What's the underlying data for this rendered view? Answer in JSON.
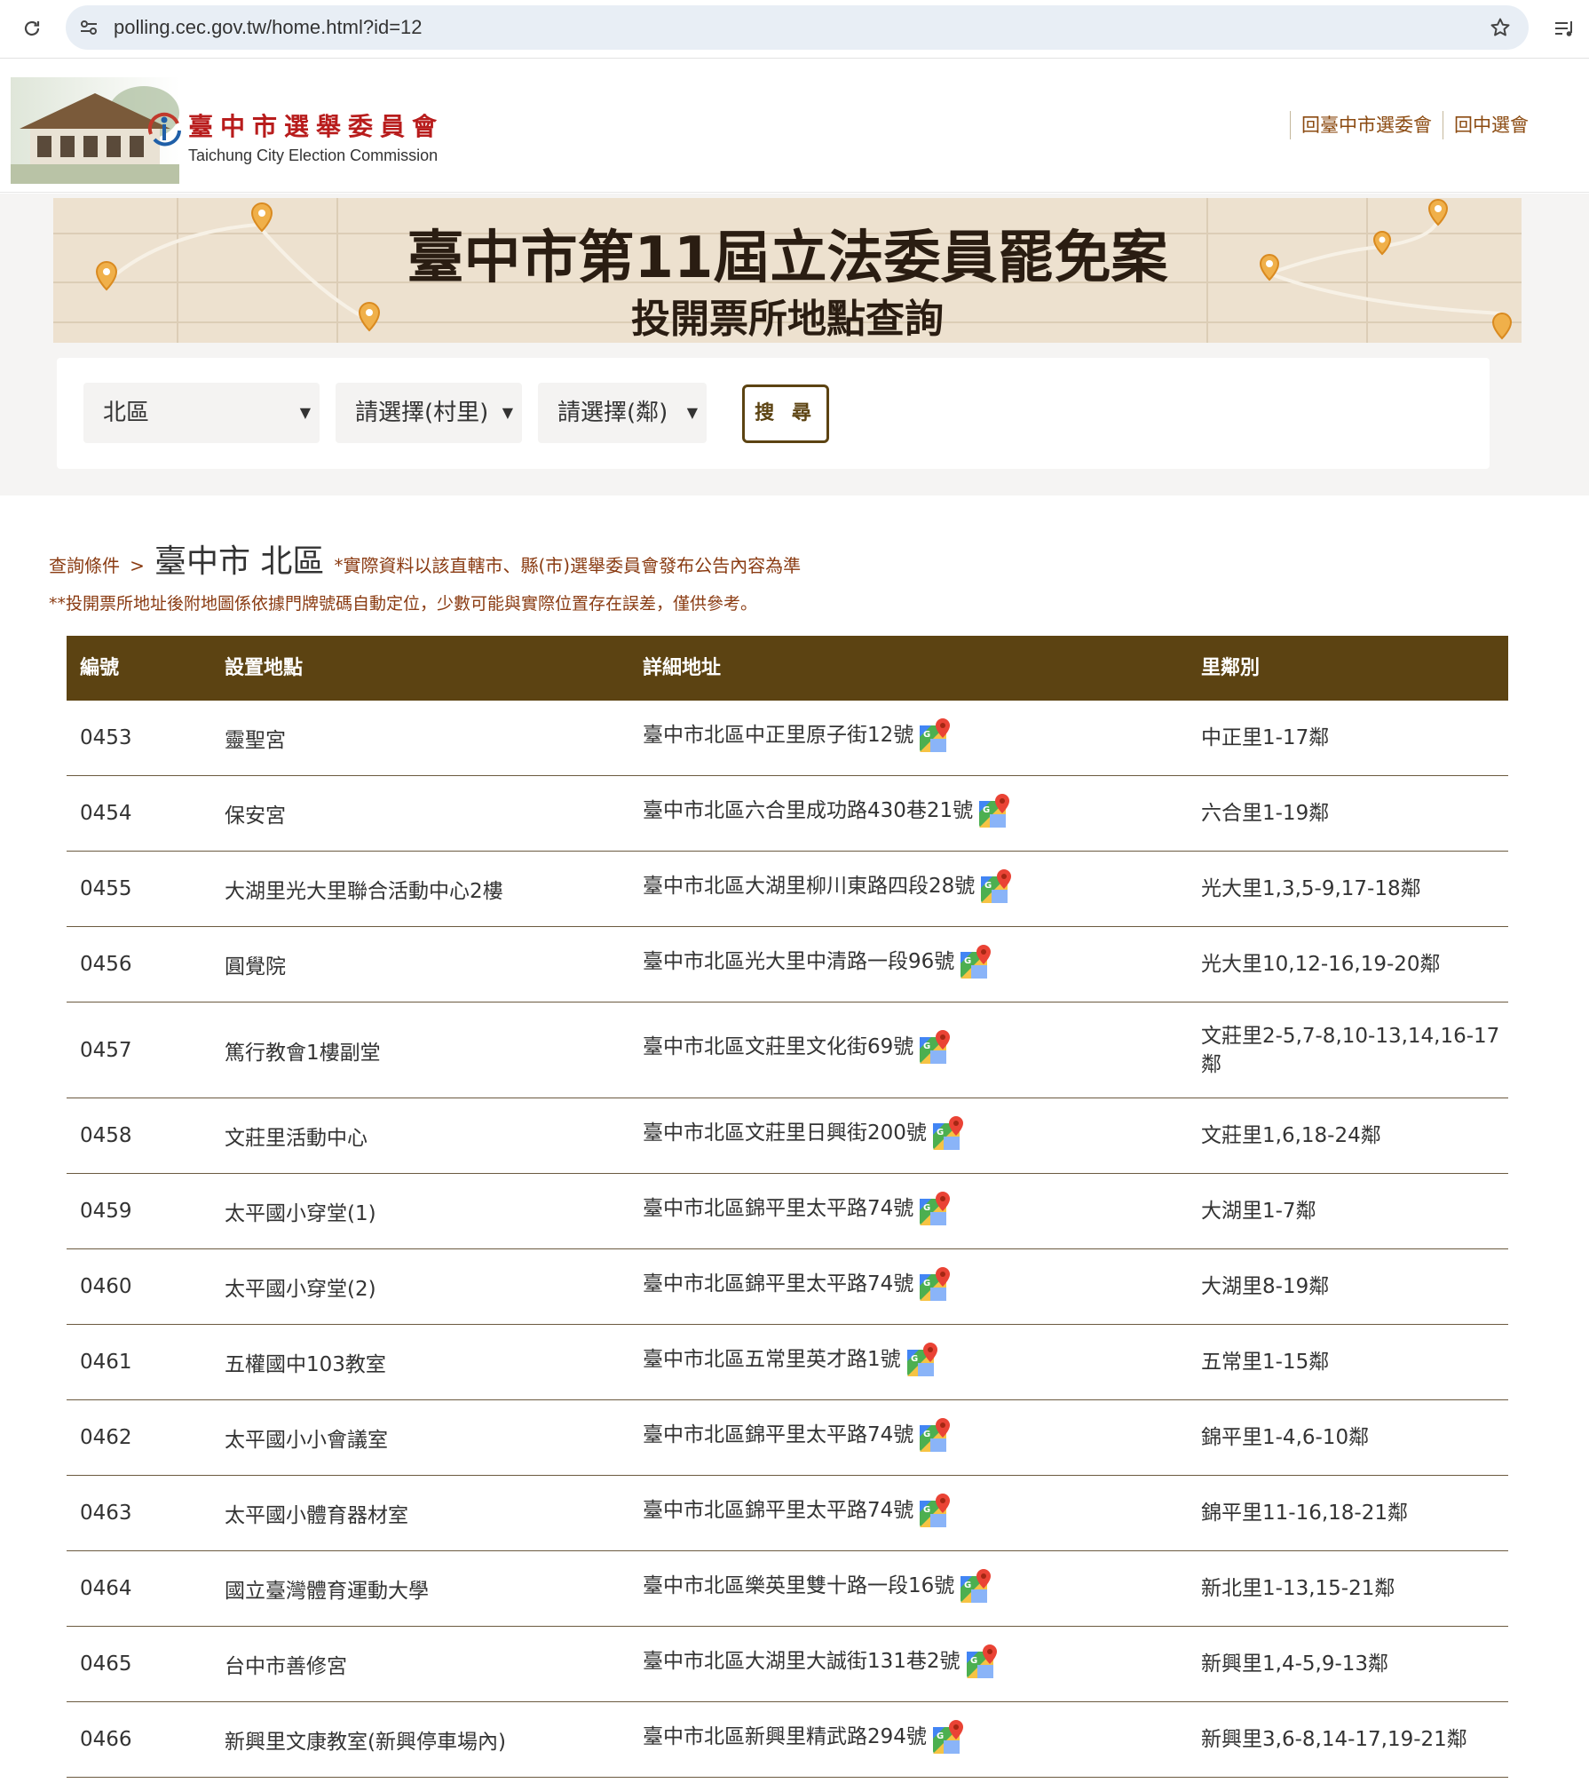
{
  "browser": {
    "url": "polling.cec.gov.tw/home.html?id=12"
  },
  "header": {
    "logo_title": "臺中市選舉委員會",
    "logo_subtitle": "Taichung City Election Commission",
    "links": [
      "回臺中市選委會",
      "回中選會"
    ]
  },
  "banner": {
    "title": "臺中市第11屆立法委員罷免案",
    "subtitle": "投開票所地點查詢"
  },
  "search": {
    "district": "北區",
    "village": "請選擇(村里)",
    "neighborhood": "請選擇(鄰)",
    "button": "搜 尋"
  },
  "result": {
    "condition_label": "查詢條件",
    "separator": ">",
    "place": "臺中市 北區",
    "note1": "*實際資料以該直轄市、縣(市)選舉委員會發布公告內容為準",
    "note2": "**投開票所地址後附地圖係依據門牌號碼自動定位，少數可能與實際位置存在誤差，僅供參考。"
  },
  "table": {
    "headers": [
      "編號",
      "設置地點",
      "詳細地址",
      "里鄰別"
    ],
    "rows": [
      {
        "id": "0453",
        "location": "靈聖宮",
        "address": "臺中市北區中正里原子街12號",
        "area": "中正里1-17鄰"
      },
      {
        "id": "0454",
        "location": "保安宮",
        "address": "臺中市北區六合里成功路430巷21號",
        "area": "六合里1-19鄰"
      },
      {
        "id": "0455",
        "location": "大湖里光大里聯合活動中心2樓",
        "address": "臺中市北區大湖里柳川東路四段28號",
        "area": "光大里1,3,5-9,17-18鄰"
      },
      {
        "id": "0456",
        "location": "圓覺院",
        "address": "臺中市北區光大里中清路一段96號",
        "area": "光大里10,12-16,19-20鄰"
      },
      {
        "id": "0457",
        "location": "篤行教會1樓副堂",
        "address": "臺中市北區文莊里文化街69號",
        "area": "文莊里2-5,7-8,10-13,14,16-17鄰"
      },
      {
        "id": "0458",
        "location": "文莊里活動中心",
        "address": "臺中市北區文莊里日興街200號",
        "area": "文莊里1,6,18-24鄰"
      },
      {
        "id": "0459",
        "location": "太平國小穿堂(1)",
        "address": "臺中市北區錦平里太平路74號",
        "area": "大湖里1-7鄰"
      },
      {
        "id": "0460",
        "location": "太平國小穿堂(2)",
        "address": "臺中市北區錦平里太平路74號",
        "area": "大湖里8-19鄰"
      },
      {
        "id": "0461",
        "location": "五權國中103教室",
        "address": "臺中市北區五常里英才路1號",
        "area": "五常里1-15鄰"
      },
      {
        "id": "0462",
        "location": "太平國小小會議室",
        "address": "臺中市北區錦平里太平路74號",
        "area": "錦平里1-4,6-10鄰"
      },
      {
        "id": "0463",
        "location": "太平國小體育器材室",
        "address": "臺中市北區錦平里太平路74號",
        "area": "錦平里11-16,18-21鄰"
      },
      {
        "id": "0464",
        "location": "國立臺灣體育運動大學",
        "address": "臺中市北區樂英里雙十路一段16號",
        "area": "新北里1-13,15-21鄰"
      },
      {
        "id": "0465",
        "location": "台中市善修宮",
        "address": "臺中市北區大湖里大誠街131巷2號",
        "area": "新興里1,4-5,9-13鄰"
      },
      {
        "id": "0466",
        "location": "新興里文康教室(新興停車場內)",
        "address": "臺中市北區新興里精武路294號",
        "area": "新興里3,6-8,14-17,19-21鄰"
      }
    ]
  }
}
